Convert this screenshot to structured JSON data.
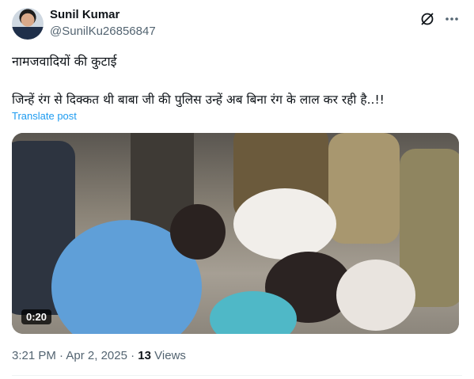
{
  "post": {
    "author_name": "Sunil Kumar",
    "author_handle": "@SunilKu26856847",
    "text_line1": "नामजवादियों की कुटाई",
    "text_line2": "जिन्हें रंग से दिक्कत थी बाबा जी की पुलिस उन्हें अब बिना रंग के लाल कर रही है..!!",
    "translate_label": "Translate post",
    "video_duration": "0:20",
    "time": "3:21 PM",
    "date": "Apr 2, 2025",
    "separator": "·",
    "views_count": "13",
    "views_label": "Views"
  },
  "icons": {
    "avatar": "avatar",
    "grok": "grok-icon",
    "more": "more-icon"
  },
  "colors": {
    "link": "#1d9bf0",
    "secondary_text": "#536471",
    "primary_text": "#0f1419"
  }
}
